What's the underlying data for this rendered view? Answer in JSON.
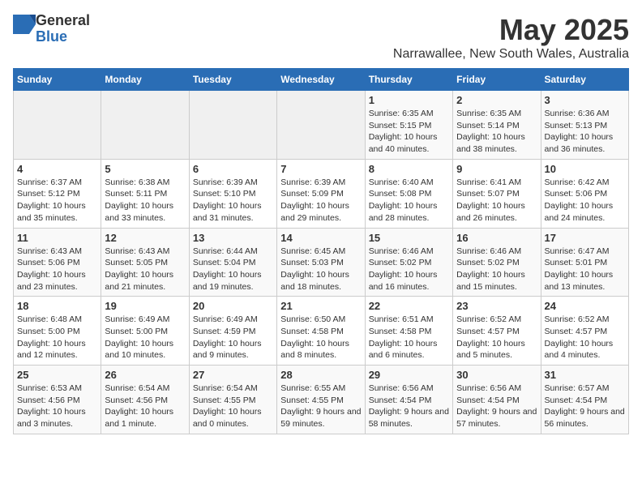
{
  "header": {
    "logo": {
      "general": "General",
      "blue": "Blue"
    },
    "month": "May 2025",
    "location": "Narrawallee, New South Wales, Australia"
  },
  "days_of_week": [
    "Sunday",
    "Monday",
    "Tuesday",
    "Wednesday",
    "Thursday",
    "Friday",
    "Saturday"
  ],
  "weeks": [
    [
      {
        "day": "",
        "empty": true
      },
      {
        "day": "",
        "empty": true
      },
      {
        "day": "",
        "empty": true
      },
      {
        "day": "",
        "empty": true
      },
      {
        "day": "1",
        "sunrise": "Sunrise: 6:35 AM",
        "sunset": "Sunset: 5:15 PM",
        "daylight": "Daylight: 10 hours and 40 minutes."
      },
      {
        "day": "2",
        "sunrise": "Sunrise: 6:35 AM",
        "sunset": "Sunset: 5:14 PM",
        "daylight": "Daylight: 10 hours and 38 minutes."
      },
      {
        "day": "3",
        "sunrise": "Sunrise: 6:36 AM",
        "sunset": "Sunset: 5:13 PM",
        "daylight": "Daylight: 10 hours and 36 minutes."
      }
    ],
    [
      {
        "day": "4",
        "sunrise": "Sunrise: 6:37 AM",
        "sunset": "Sunset: 5:12 PM",
        "daylight": "Daylight: 10 hours and 35 minutes."
      },
      {
        "day": "5",
        "sunrise": "Sunrise: 6:38 AM",
        "sunset": "Sunset: 5:11 PM",
        "daylight": "Daylight: 10 hours and 33 minutes."
      },
      {
        "day": "6",
        "sunrise": "Sunrise: 6:39 AM",
        "sunset": "Sunset: 5:10 PM",
        "daylight": "Daylight: 10 hours and 31 minutes."
      },
      {
        "day": "7",
        "sunrise": "Sunrise: 6:39 AM",
        "sunset": "Sunset: 5:09 PM",
        "daylight": "Daylight: 10 hours and 29 minutes."
      },
      {
        "day": "8",
        "sunrise": "Sunrise: 6:40 AM",
        "sunset": "Sunset: 5:08 PM",
        "daylight": "Daylight: 10 hours and 28 minutes."
      },
      {
        "day": "9",
        "sunrise": "Sunrise: 6:41 AM",
        "sunset": "Sunset: 5:07 PM",
        "daylight": "Daylight: 10 hours and 26 minutes."
      },
      {
        "day": "10",
        "sunrise": "Sunrise: 6:42 AM",
        "sunset": "Sunset: 5:06 PM",
        "daylight": "Daylight: 10 hours and 24 minutes."
      }
    ],
    [
      {
        "day": "11",
        "sunrise": "Sunrise: 6:43 AM",
        "sunset": "Sunset: 5:06 PM",
        "daylight": "Daylight: 10 hours and 23 minutes."
      },
      {
        "day": "12",
        "sunrise": "Sunrise: 6:43 AM",
        "sunset": "Sunset: 5:05 PM",
        "daylight": "Daylight: 10 hours and 21 minutes."
      },
      {
        "day": "13",
        "sunrise": "Sunrise: 6:44 AM",
        "sunset": "Sunset: 5:04 PM",
        "daylight": "Daylight: 10 hours and 19 minutes."
      },
      {
        "day": "14",
        "sunrise": "Sunrise: 6:45 AM",
        "sunset": "Sunset: 5:03 PM",
        "daylight": "Daylight: 10 hours and 18 minutes."
      },
      {
        "day": "15",
        "sunrise": "Sunrise: 6:46 AM",
        "sunset": "Sunset: 5:02 PM",
        "daylight": "Daylight: 10 hours and 16 minutes."
      },
      {
        "day": "16",
        "sunrise": "Sunrise: 6:46 AM",
        "sunset": "Sunset: 5:02 PM",
        "daylight": "Daylight: 10 hours and 15 minutes."
      },
      {
        "day": "17",
        "sunrise": "Sunrise: 6:47 AM",
        "sunset": "Sunset: 5:01 PM",
        "daylight": "Daylight: 10 hours and 13 minutes."
      }
    ],
    [
      {
        "day": "18",
        "sunrise": "Sunrise: 6:48 AM",
        "sunset": "Sunset: 5:00 PM",
        "daylight": "Daylight: 10 hours and 12 minutes."
      },
      {
        "day": "19",
        "sunrise": "Sunrise: 6:49 AM",
        "sunset": "Sunset: 5:00 PM",
        "daylight": "Daylight: 10 hours and 10 minutes."
      },
      {
        "day": "20",
        "sunrise": "Sunrise: 6:49 AM",
        "sunset": "Sunset: 4:59 PM",
        "daylight": "Daylight: 10 hours and 9 minutes."
      },
      {
        "day": "21",
        "sunrise": "Sunrise: 6:50 AM",
        "sunset": "Sunset: 4:58 PM",
        "daylight": "Daylight: 10 hours and 8 minutes."
      },
      {
        "day": "22",
        "sunrise": "Sunrise: 6:51 AM",
        "sunset": "Sunset: 4:58 PM",
        "daylight": "Daylight: 10 hours and 6 minutes."
      },
      {
        "day": "23",
        "sunrise": "Sunrise: 6:52 AM",
        "sunset": "Sunset: 4:57 PM",
        "daylight": "Daylight: 10 hours and 5 minutes."
      },
      {
        "day": "24",
        "sunrise": "Sunrise: 6:52 AM",
        "sunset": "Sunset: 4:57 PM",
        "daylight": "Daylight: 10 hours and 4 minutes."
      }
    ],
    [
      {
        "day": "25",
        "sunrise": "Sunrise: 6:53 AM",
        "sunset": "Sunset: 4:56 PM",
        "daylight": "Daylight: 10 hours and 3 minutes."
      },
      {
        "day": "26",
        "sunrise": "Sunrise: 6:54 AM",
        "sunset": "Sunset: 4:56 PM",
        "daylight": "Daylight: 10 hours and 1 minute."
      },
      {
        "day": "27",
        "sunrise": "Sunrise: 6:54 AM",
        "sunset": "Sunset: 4:55 PM",
        "daylight": "Daylight: 10 hours and 0 minutes."
      },
      {
        "day": "28",
        "sunrise": "Sunrise: 6:55 AM",
        "sunset": "Sunset: 4:55 PM",
        "daylight": "Daylight: 9 hours and 59 minutes."
      },
      {
        "day": "29",
        "sunrise": "Sunrise: 6:56 AM",
        "sunset": "Sunset: 4:54 PM",
        "daylight": "Daylight: 9 hours and 58 minutes."
      },
      {
        "day": "30",
        "sunrise": "Sunrise: 6:56 AM",
        "sunset": "Sunset: 4:54 PM",
        "daylight": "Daylight: 9 hours and 57 minutes."
      },
      {
        "day": "31",
        "sunrise": "Sunrise: 6:57 AM",
        "sunset": "Sunset: 4:54 PM",
        "daylight": "Daylight: 9 hours and 56 minutes."
      }
    ]
  ]
}
